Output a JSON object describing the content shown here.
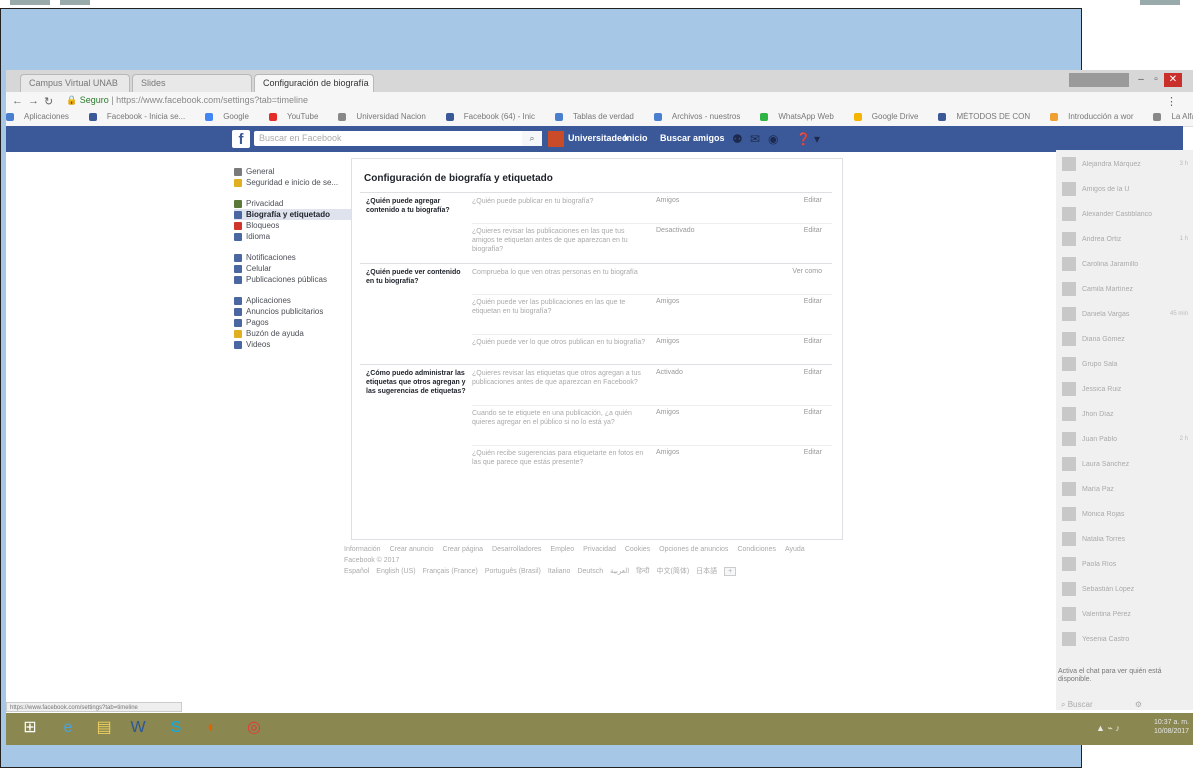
{
  "browser": {
    "tabs": [
      {
        "label": "Campus Virtual UNAB"
      },
      {
        "label": "Slides"
      },
      {
        "label": "Configuración de biografía"
      }
    ],
    "url_secure": "Seguro",
    "url": "https://www.facebook.com/settings?tab=timeline",
    "bookmarks": [
      {
        "label": "Aplicaciones",
        "color": "#4a7fd0"
      },
      {
        "label": "Facebook - Inicia se...",
        "color": "#3b5998"
      },
      {
        "label": "Google",
        "color": "#4285f4"
      },
      {
        "label": "YouTube",
        "color": "#e52d27"
      },
      {
        "label": "Universidad Nacion",
        "color": "#888888"
      },
      {
        "label": "Facebook (64) - Inic",
        "color": "#3b5998"
      },
      {
        "label": "Tablas de verdad",
        "color": "#4a7fd0"
      },
      {
        "label": "Archivos - nuestros",
        "color": "#4a7fd0"
      },
      {
        "label": "WhatsApp Web",
        "color": "#2fb344"
      },
      {
        "label": "Google Drive",
        "color": "#f4b400"
      },
      {
        "label": "MÉTODOS DE CON",
        "color": "#3b5998"
      },
      {
        "label": "Introducción a wor",
        "color": "#f0a030"
      },
      {
        "label": "La Alfabetización F",
        "color": "#888888"
      }
    ]
  },
  "fb": {
    "search_placeholder": "Buscar en Facebook",
    "user": "Universitadeo",
    "inicio": "Inicio",
    "find_friends": "Buscar amigos"
  },
  "leftnav": {
    "groups": [
      [
        {
          "label": "General",
          "icon": "gear-icon",
          "color": "#7a7a7a"
        },
        {
          "label": "Seguridad e inicio de se...",
          "icon": "shield-icon",
          "color": "#e0b020"
        }
      ],
      [
        {
          "label": "Privacidad",
          "icon": "lock-icon",
          "color": "#5b7a3a"
        },
        {
          "label": "Biografía y etiquetado",
          "icon": "timeline-icon",
          "color": "#4b67a1",
          "active": true
        },
        {
          "label": "Bloqueos",
          "icon": "block-icon",
          "color": "#d0352a"
        },
        {
          "label": "Idioma",
          "icon": "language-icon",
          "color": "#4b67a1"
        }
      ],
      [
        {
          "label": "Notificaciones",
          "icon": "globe-icon",
          "color": "#4b67a1"
        },
        {
          "label": "Celular",
          "icon": "mobile-icon",
          "color": "#4b67a1"
        },
        {
          "label": "Publicaciones públicas",
          "icon": "rss-icon",
          "color": "#4b67a1"
        }
      ],
      [
        {
          "label": "Aplicaciones",
          "icon": "apps-icon",
          "color": "#4b67a1"
        },
        {
          "label": "Anuncios publicitarios",
          "icon": "ads-icon",
          "color": "#4b67a1"
        },
        {
          "label": "Pagos",
          "icon": "payments-icon",
          "color": "#4b67a1"
        },
        {
          "label": "Buzón de ayuda",
          "icon": "help-icon",
          "color": "#e0b020"
        },
        {
          "label": "Videos",
          "icon": "video-icon",
          "color": "#4b67a1"
        }
      ]
    ]
  },
  "main": {
    "title": "Configuración de biografía y etiquetado",
    "sections": [
      {
        "label": "¿Quién puede agregar contenido a tu biografía?",
        "rows": [
          {
            "question": "¿Quién puede publicar en tu biografía?",
            "value": "Amigos",
            "action": "Editar"
          },
          {
            "question": "¿Quieres revisar las publicaciones en las que tus amigos te etiquetan antes de que aparezcan en tu biografía?",
            "value": "Desactivado",
            "action": "Editar"
          }
        ]
      },
      {
        "label": "¿Quién puede ver contenido en tu biografía?",
        "rows": [
          {
            "question": "Comprueba lo que ven otras personas en tu biografía",
            "value": "",
            "action": "Ver como"
          },
          {
            "question": "¿Quién puede ver las publicaciones en las que te etiquetan en tu biografía?",
            "value": "Amigos",
            "action": "Editar"
          },
          {
            "question": "¿Quién puede ver lo que otros publican en tu biografía?",
            "value": "Amigos",
            "action": "Editar"
          }
        ]
      },
      {
        "label": "¿Cómo puedo administrar las etiquetas que otros agregan y las sugerencias de etiquetas?",
        "rows": [
          {
            "question": "¿Quieres revisar las etiquetas que otros agregan a tus publicaciones antes de que aparezcan en Facebook?",
            "value": "Activado",
            "action": "Editar"
          },
          {
            "question": "Cuando se te etiquete en una publicación, ¿a quién quieres agregar en el público si no lo está ya?",
            "value": "Amigos",
            "action": "Editar"
          },
          {
            "question": "¿Quién recibe sugerencias para etiquetarte en fotos en las que parece que estás presente?",
            "value": "Amigos",
            "action": "Editar"
          }
        ]
      }
    ]
  },
  "footer": {
    "links": [
      "Información",
      "Crear anuncio",
      "Crear página",
      "Desarrolladores",
      "Empleo",
      "Privacidad",
      "Cookies",
      "Opciones de anuncios",
      "Condiciones",
      "Ayuda"
    ],
    "copyright": "Facebook © 2017",
    "languages": [
      "Español",
      "English (US)",
      "Français (France)",
      "Português (Brasil)",
      "Italiano",
      "Deutsch",
      "العربية",
      "हिन्दी",
      "中文(简体)",
      "日本語"
    ],
    "more_languages": "+"
  },
  "chat": {
    "contacts": [
      {
        "name": "Alejandra Márquez",
        "time": "3 h"
      },
      {
        "name": "Amigos de la U",
        "time": ""
      },
      {
        "name": "Alexander Castiblanco",
        "time": ""
      },
      {
        "name": "Andrea Ortiz",
        "time": "1 h"
      },
      {
        "name": "Carolina Jaramillo",
        "time": ""
      },
      {
        "name": "Camila Martínez",
        "time": ""
      },
      {
        "name": "Daniela Vargas",
        "time": "45 min"
      },
      {
        "name": "Diana Gómez",
        "time": ""
      },
      {
        "name": "Grupo Sala",
        "time": ""
      },
      {
        "name": "Jessica Ruiz",
        "time": ""
      },
      {
        "name": "Jhon Díaz",
        "time": ""
      },
      {
        "name": "Juan Pablo",
        "time": "2 h"
      },
      {
        "name": "Laura Sánchez",
        "time": ""
      },
      {
        "name": "María Paz",
        "time": ""
      },
      {
        "name": "Mónica Rojas",
        "time": ""
      },
      {
        "name": "Natalia Torres",
        "time": ""
      },
      {
        "name": "Paola Ríos",
        "time": ""
      },
      {
        "name": "Sebastián López",
        "time": ""
      },
      {
        "name": "Valentina Pérez",
        "time": ""
      },
      {
        "name": "Yesenia Castro",
        "time": ""
      }
    ],
    "tip": "Activa el chat para ver quién está disponible.",
    "search_label": "Buscar"
  },
  "status_url": "https://www.facebook.com/settings?tab=timeline",
  "taskbar": {
    "time": "10:37 a. m.",
    "date": "10/08/2017"
  },
  "colors": {
    "fb_blue": "#3b5998",
    "frame_blue": "#a7c7e7",
    "taskbar": "#8a8750"
  }
}
